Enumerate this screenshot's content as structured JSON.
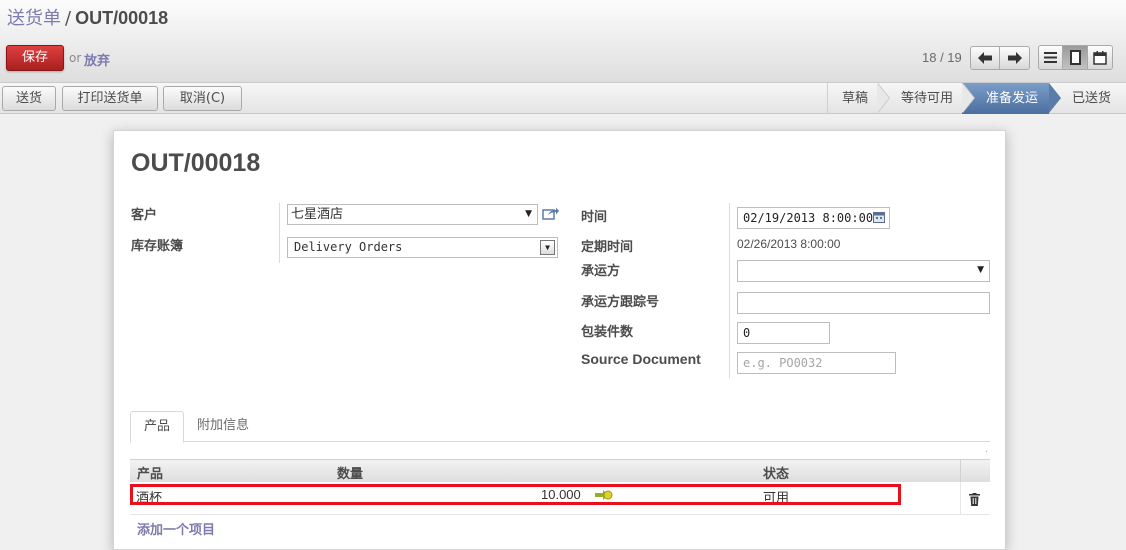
{
  "breadcrumb": {
    "parent": "送货单",
    "separator": "/",
    "current": "OUT/00018"
  },
  "toolbar": {
    "save_label": "保存",
    "or_text": "or",
    "discard_label": "放弃"
  },
  "pager": {
    "text": "18 / 19"
  },
  "actions": {
    "deliver_label": "送货",
    "print_label": "打印送货单",
    "cancel_label": "取消(C)"
  },
  "stages": [
    {
      "label": "草稿",
      "active": false
    },
    {
      "label": "等待可用",
      "active": false
    },
    {
      "label": "准备发运",
      "active": true
    },
    {
      "label": "已送货",
      "active": false
    }
  ],
  "record": {
    "title": "OUT/00018",
    "customer_label": "客户",
    "customer_value": "七星酒店",
    "journal_label": "库存账簿",
    "journal_value": "Delivery Orders",
    "date_label": "时间",
    "date_value": "02/19/2013 8:00:00",
    "scheduled_label": "定期时间",
    "scheduled_value": "02/26/2013 8:00:00",
    "carrier_label": "承运方",
    "carrier_value": "",
    "tracking_label": "承运方跟踪号",
    "tracking_value": "",
    "packages_label": "包装件数",
    "packages_value": "0",
    "source_label": "Source Document",
    "source_placeholder": "e.g. PO0032"
  },
  "tabs": [
    {
      "label": "产品",
      "active": true
    },
    {
      "label": "附加信息",
      "active": false
    }
  ],
  "table": {
    "headers": {
      "product": "产品",
      "quantity": "数量",
      "status": "状态"
    },
    "rows": [
      {
        "product": "酒杯",
        "quantity": "10.000",
        "status": "可用"
      }
    ],
    "add_label": "添加一个项目"
  },
  "colors": {
    "accent": "#7c7bad",
    "save": "#c62f2f",
    "active_stage": "#5a7cab",
    "highlight": "#e8101b"
  }
}
